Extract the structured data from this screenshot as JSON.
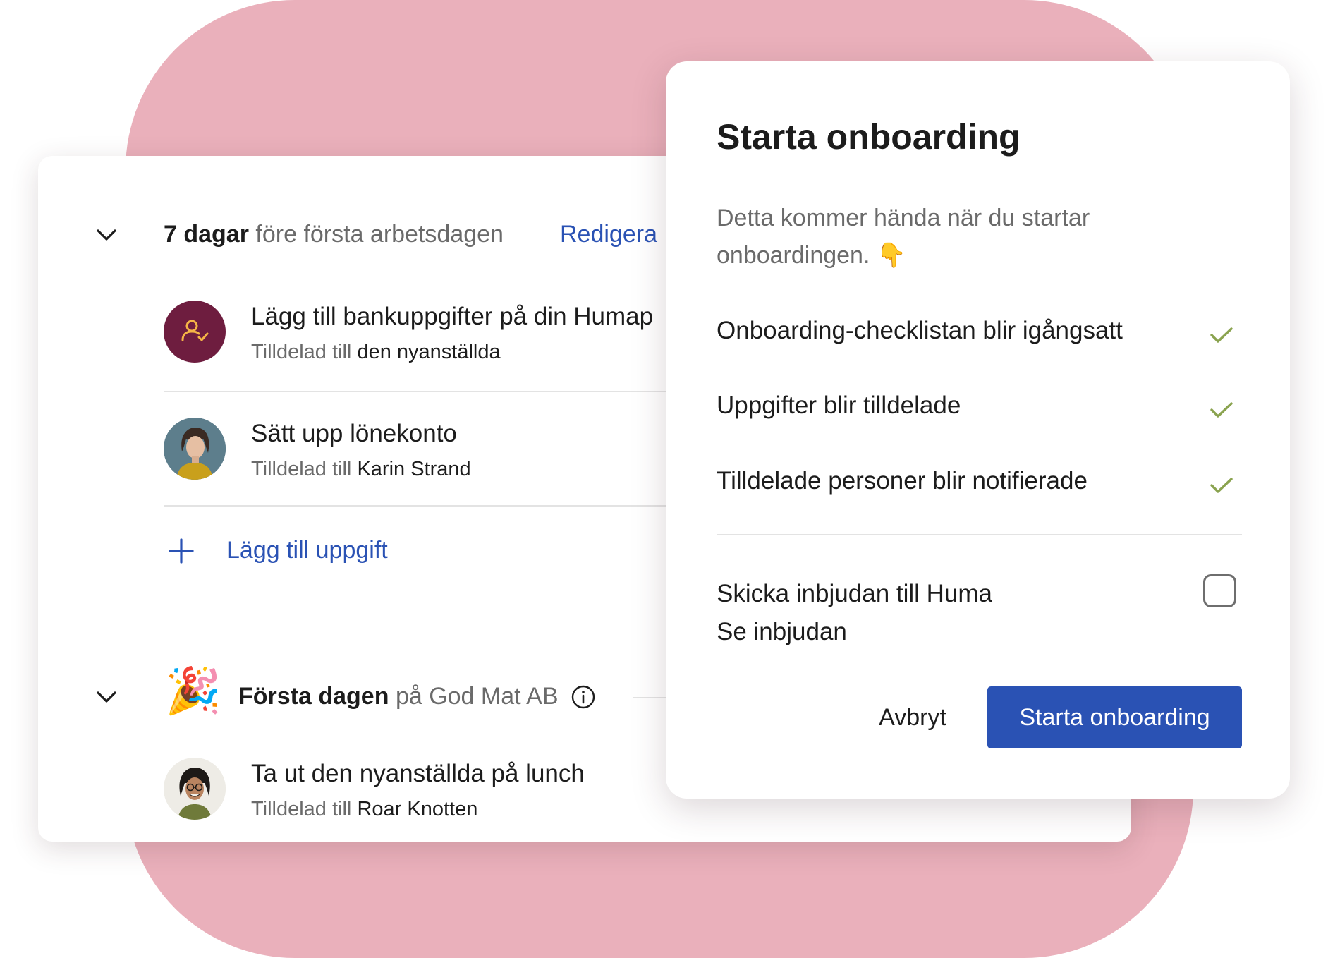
{
  "colors": {
    "background_blob": "#eab0bb",
    "accent_blue": "#2a52b4",
    "check_green": "#8aa34f",
    "avatar_maroon": "#6e1d3f"
  },
  "tasks_panel": {
    "section1": {
      "bold": "7 dagar",
      "rest": "före första arbetsdagen",
      "edit_link": "Redigera"
    },
    "tasks": [
      {
        "title": "Lägg till bankuppgifter på din Humap",
        "assigned_prefix": "Tilldelad till",
        "assignee": "den nyanställda",
        "avatar_icon": "user-check-icon"
      },
      {
        "title": "Sätt upp lönekonto",
        "assigned_prefix": "Tilldelad till",
        "assignee": "Karin Strand",
        "avatar_icon": "person-photo"
      }
    ],
    "add_task": "Lägg till uppgift",
    "section2": {
      "emoji": "🎉",
      "bold": "Första dagen",
      "rest": "på God Mat AB",
      "info_icon": "info-icon"
    },
    "tasks2": [
      {
        "title": "Ta ut den nyanställda på lunch",
        "assigned_prefix": "Tilldelad till",
        "assignee": "Roar Knotten",
        "avatar_icon": "person-photo"
      }
    ]
  },
  "modal": {
    "title": "Starta onboarding",
    "description": "Detta kommer hända när du startar onboardingen. 👇",
    "checklist": [
      "Onboarding-checklistan blir igångsatt",
      "Uppgifter blir tilldelade",
      "Tilldelade personer blir notifierade"
    ],
    "invite_label": "Skicka inbjudan till Huma",
    "invite_checked": false,
    "see_invite": "Se inbjudan",
    "cancel_button": "Avbryt",
    "start_button": "Starta onboarding"
  }
}
